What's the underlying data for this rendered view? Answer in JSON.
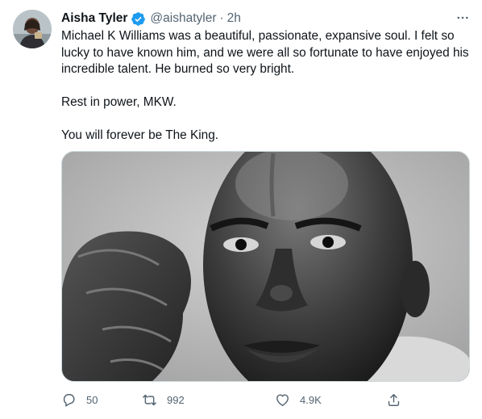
{
  "author": {
    "name": "Aisha Tyler",
    "handle": "@aishatyler",
    "separator": "·",
    "time": "2h",
    "verified": true
  },
  "icons": {
    "verified": "verified-badge-icon",
    "more": "more-dots-icon",
    "reply": "reply-icon",
    "retweet": "retweet-icon",
    "like": "heart-icon",
    "share": "share-icon"
  },
  "tweet": {
    "paragraphs": [
      "Michael K Williams was a beautiful, passionate, expansive soul. I felt so lucky to have known him, and we were all so fortunate to have enjoyed his incredible talent. He burned so very bright.",
      "Rest in power, MKW.",
      "You will forever be The King."
    ]
  },
  "stats": {
    "replies": "50",
    "retweets": "992",
    "likes": "4.9K"
  },
  "colors": {
    "text": "#0f1419",
    "secondary": "#536471",
    "verified": "#1d9bf0",
    "border": "#cfd9de"
  }
}
